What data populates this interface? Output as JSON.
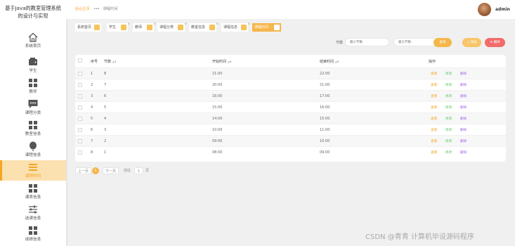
{
  "app": {
    "title_line1": "基于Java的教室管理系统",
    "title_line2": "的设计与实现"
  },
  "sidebar": {
    "items": [
      {
        "label": "系统首页",
        "icon": "home-icon"
      },
      {
        "label": "学生",
        "icon": "wallet-icon"
      },
      {
        "label": "教师",
        "icon": "grid-icon"
      },
      {
        "label": "课程分类",
        "icon": "chat-icon"
      },
      {
        "label": "教室信息",
        "icon": "grid-icon"
      },
      {
        "label": "课程信息",
        "icon": "balloon-icon"
      },
      {
        "label": "课程时间",
        "icon": "list-icon"
      },
      {
        "label": "课表信息",
        "icon": "grid-icon"
      },
      {
        "label": "选课信息",
        "icon": "sliders-icon"
      },
      {
        "label": "成绩信息",
        "icon": "grid-icon"
      }
    ],
    "active_index": 6
  },
  "topbar": {
    "breadcrumb_home": "后台主页",
    "breadcrumb_sep": "•••",
    "breadcrumb_current": "课程时间",
    "username": "admin"
  },
  "tabs": [
    {
      "label": "系统首页"
    },
    {
      "label": "学生"
    },
    {
      "label": "教师"
    },
    {
      "label": "课程分类"
    },
    {
      "label": "教室信息"
    },
    {
      "label": "课程信息"
    },
    {
      "label": "课程时间"
    }
  ],
  "search": {
    "label": "节数",
    "min_placeholder": "最小节数",
    "max_placeholder": "最大节数",
    "search_btn": "查询",
    "add_btn": "+ 添加",
    "delete_btn": "⊖ 删除"
  },
  "table": {
    "headers": {
      "index": "序号",
      "section": "节数",
      "start": "开始时间",
      "end": "结束时间",
      "ops": "操作"
    },
    "actions": {
      "view": "查看",
      "edit": "修改",
      "delete": "删除"
    },
    "rows": [
      {
        "index": "1",
        "section": "8",
        "start": "21:00",
        "end": "22:00"
      },
      {
        "index": "2",
        "section": "7",
        "start": "20:00",
        "end": "21:00"
      },
      {
        "index": "3",
        "section": "6",
        "start": "16:00",
        "end": "17:00"
      },
      {
        "index": "4",
        "section": "5",
        "start": "15:00",
        "end": "16:00"
      },
      {
        "index": "5",
        "section": "4",
        "start": "14:00",
        "end": "15:00"
      },
      {
        "index": "6",
        "section": "3",
        "start": "10:00",
        "end": "11:00"
      },
      {
        "index": "7",
        "section": "2",
        "start": "09:00",
        "end": "10:00"
      },
      {
        "index": "8",
        "section": "1",
        "start": "08:00",
        "end": "09:00"
      }
    ]
  },
  "pagination": {
    "prev": "上一页",
    "current": "1",
    "next": "下一页",
    "goto_label": "前往",
    "goto_value": "1",
    "page_suffix": "页"
  },
  "watermark": "CSDN @青青  计算机毕设源码程序",
  "colors": {
    "accent": "#f5a623",
    "delete": "#f26b6b",
    "edit": "#5cc96b",
    "delete_link": "#a15ff2"
  }
}
